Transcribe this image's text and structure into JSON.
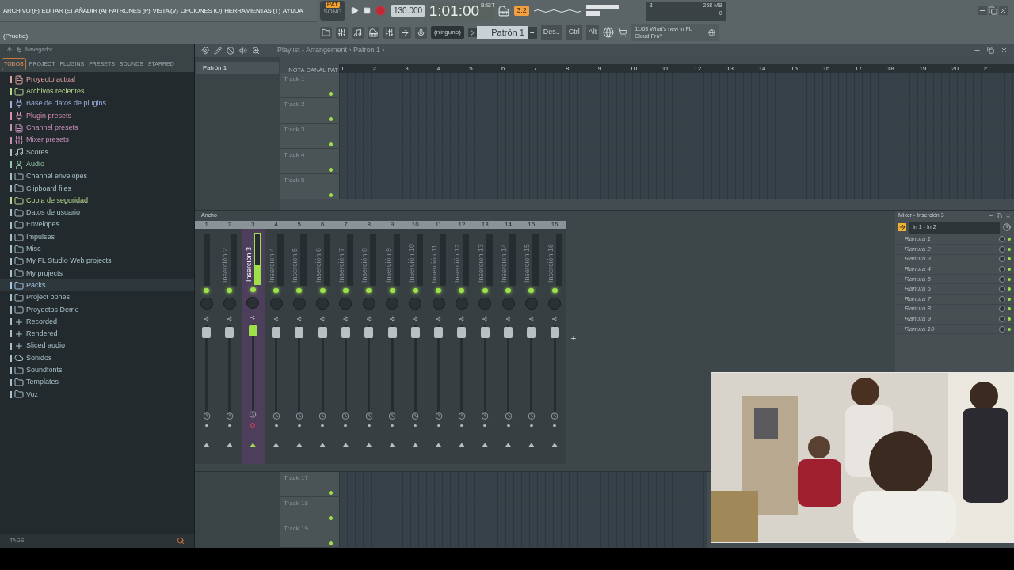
{
  "menu": [
    "ARCHIVO (F)",
    "EDITAR (E)",
    "AÑADIR (A)",
    "PATRONES (P)",
    "VISTA (V)",
    "OPCIONES (O)",
    "HERRAMIENTAS (T)",
    "AYUDA"
  ],
  "transport": {
    "metronome": "3:2",
    "pat_label": "PAT",
    "song_label": "SONG",
    "mode_pat": true,
    "recording": false,
    "tempo": "130.000",
    "time": "1:01:00",
    "time_unit": "B:S:T"
  },
  "memory": {
    "voices": "3",
    "ram": "258 MB",
    "cpu": "0"
  },
  "hint": "(Prueba)",
  "toolbar": {
    "midi": "(ninguno)",
    "pattern": "Patrón 1",
    "add": "+",
    "buttons": [
      "Des..",
      "Ctrl",
      "Alt"
    ],
    "news_date": "11/03",
    "news": "What's new in FL Cloud Pro?"
  },
  "browser": {
    "title": "Navegador",
    "tabs": [
      {
        "label": "TODOS",
        "selected": true
      },
      {
        "label": "PROJECT",
        "selected": false
      },
      {
        "label": "PLUGINS",
        "selected": false
      },
      {
        "label": "PRESETS",
        "selected": false
      },
      {
        "label": "SOUNDS",
        "selected": false
      },
      {
        "label": "STARRED",
        "selected": false
      }
    ],
    "items": [
      {
        "label": "Proyecto actual",
        "kind": "file",
        "color": "#e0a0a0",
        "selected": false
      },
      {
        "label": "Archivos recientes",
        "kind": "folder",
        "color": "#b8d890",
        "selected": false
      },
      {
        "label": "Base de datos de plugins",
        "kind": "plug",
        "color": "#9fb0e0",
        "selected": false
      },
      {
        "label": "Plugin presets",
        "kind": "plug",
        "color": "#d890b0",
        "selected": false
      },
      {
        "label": "Channel presets",
        "kind": "file",
        "color": "#c890b8",
        "selected": false
      },
      {
        "label": "Mixer presets",
        "kind": "sliders",
        "color": "#c890b8",
        "selected": false
      },
      {
        "label": "Scores",
        "kind": "note",
        "color": "#b0c0c0",
        "selected": false
      },
      {
        "label": "Audio",
        "kind": "user",
        "color": "#90c8a8",
        "selected": false
      },
      {
        "label": "Channel envelopes",
        "kind": "folder",
        "color": "#a8c0c8",
        "selected": false
      },
      {
        "label": "Clipboard files",
        "kind": "folder",
        "color": "#a8c0c8",
        "selected": false
      },
      {
        "label": "Copia de seguridad",
        "kind": "folder",
        "color": "#b8d890",
        "selected": false
      },
      {
        "label": "Datos de usuario",
        "kind": "folder",
        "color": "#a8c0c8",
        "selected": false
      },
      {
        "label": "Envelopes",
        "kind": "folder",
        "color": "#a8c0c8",
        "selected": false
      },
      {
        "label": "Impulses",
        "kind": "folder",
        "color": "#a8c0c8",
        "selected": false
      },
      {
        "label": "Misc",
        "kind": "folder",
        "color": "#a8c0c8",
        "selected": false
      },
      {
        "label": "My FL Studio Web projects",
        "kind": "folder",
        "color": "#a8c0c8",
        "selected": false
      },
      {
        "label": "My projects",
        "kind": "folder",
        "color": "#a8c0c8",
        "selected": false
      },
      {
        "label": "Packs",
        "kind": "folder",
        "color": "#a8c8e8",
        "selected": true
      },
      {
        "label": "Project bones",
        "kind": "folder",
        "color": "#a8c0c8",
        "selected": false
      },
      {
        "label": "Proyectos Demo",
        "kind": "folder",
        "color": "#a8c0c8",
        "selected": false
      },
      {
        "label": "Recorded",
        "kind": "plus",
        "color": "#a8c0c8",
        "selected": false
      },
      {
        "label": "Rendered",
        "kind": "plus",
        "color": "#a8c0c8",
        "selected": false
      },
      {
        "label": "Sliced audio",
        "kind": "plus",
        "color": "#a8c0c8",
        "selected": false
      },
      {
        "label": "Sonidos",
        "kind": "cloud",
        "color": "#a8c0c8",
        "selected": false
      },
      {
        "label": "Soundfonts",
        "kind": "folder",
        "color": "#a8c0c8",
        "selected": false
      },
      {
        "label": "Templates",
        "kind": "folder",
        "color": "#a8c0c8",
        "selected": false
      },
      {
        "label": "Voz",
        "kind": "folder",
        "color": "#a8c0c8",
        "selected": false
      }
    ],
    "tags": "TAGS"
  },
  "playlist": {
    "title": "Playlist - Arrangement › Patrón 1 ›",
    "tool_labels": [
      "NOTA",
      "CANAL",
      "PAT"
    ],
    "patterns": [
      "Patrón 1"
    ],
    "ruler": [
      "1",
      "2",
      "3",
      "4",
      "5",
      "6",
      "7",
      "8",
      "9",
      "10",
      "11",
      "12",
      "13",
      "14",
      "15",
      "16",
      "17",
      "18",
      "19",
      "20",
      "21"
    ],
    "tracks": [
      "Track 1",
      "Track 2",
      "Track 3",
      "Track 4",
      "Track 5"
    ],
    "lower_tracks": [
      "Track 17",
      "Track 18",
      "Track 19"
    ]
  },
  "mixer": {
    "title": "Ancho",
    "strips": [
      {
        "number": "1",
        "selected": false,
        "armed": false
      },
      {
        "number": "2",
        "label": "Inserción 2",
        "selected": false,
        "armed": false
      },
      {
        "number": "3",
        "label": "Inserción 3",
        "selected": true,
        "armed": true
      },
      {
        "number": "4",
        "label": "Inserción 4",
        "selected": false,
        "armed": false
      },
      {
        "number": "5",
        "label": "Inserción 5",
        "selected": false,
        "armed": false
      },
      {
        "number": "6",
        "label": "Inserción 6",
        "selected": false,
        "armed": false
      },
      {
        "number": "7",
        "label": "Inserción 7",
        "selected": false,
        "armed": false
      },
      {
        "number": "8",
        "label": "Inserción 8",
        "selected": false,
        "armed": false
      },
      {
        "number": "9",
        "label": "Inserción 9",
        "selected": false,
        "armed": false
      },
      {
        "number": "10",
        "label": "Inserción 10",
        "selected": false,
        "armed": false
      },
      {
        "number": "11",
        "label": "Inserción 11",
        "selected": false,
        "armed": false
      },
      {
        "number": "12",
        "label": "Inserción 12",
        "selected": false,
        "armed": false
      },
      {
        "number": "13",
        "label": "Inserción 13",
        "selected": false,
        "armed": false
      },
      {
        "number": "14",
        "label": "Inserción 14",
        "selected": false,
        "armed": false
      },
      {
        "number": "15",
        "label": "Inserción 15",
        "selected": false,
        "armed": false
      },
      {
        "number": "16",
        "label": "Inserción 16",
        "selected": false,
        "armed": false
      }
    ],
    "add": "+"
  },
  "insert_panel": {
    "title": "Mixer - Inserción 3",
    "input": "In 1 - In 2",
    "slots": [
      "Ranura 1",
      "Ranura 2",
      "Ranura 3",
      "Ranura 4",
      "Ranura 5",
      "Ranura 6",
      "Ranura 7",
      "Ranura 8",
      "Ranura 9",
      "Ranura 10"
    ]
  }
}
